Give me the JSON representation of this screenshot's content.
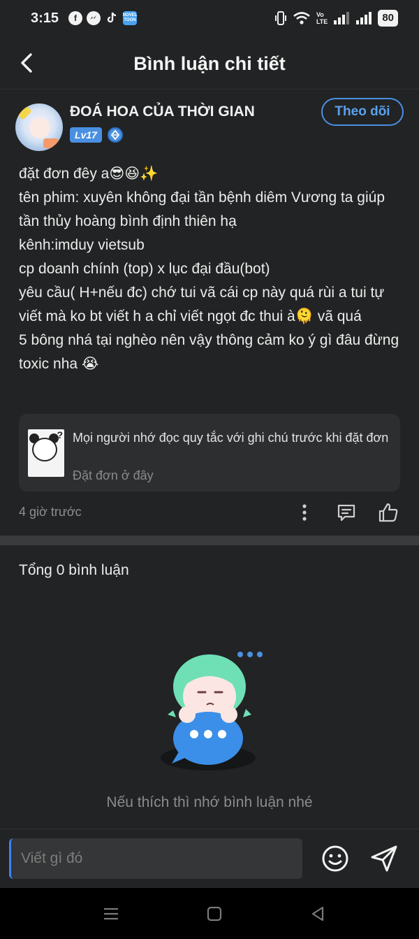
{
  "status_bar": {
    "time": "3:15",
    "apps": [
      "facebook-icon",
      "messenger-icon",
      "tiktok-icon",
      "novel-toon-icon"
    ],
    "novel_toon_label": "NOVEL TOON",
    "lte_label_top": "Vo",
    "lte_label_bottom": "LTE",
    "battery": "80"
  },
  "header": {
    "title": "Bình luận chi tiết"
  },
  "author": {
    "name": "ĐOÁ HOA CỦA THỜI GIAN",
    "level": "Lv17",
    "follow_label": "Theo dõi"
  },
  "post": {
    "lines": [
      "đặt đơn đêy a😎😆✨",
      "tên phim: xuyên không đại tần bệnh diêm Vương ta giúp tần thủy hoàng bình định thiên hạ",
      "kênh:imduy vietsub",
      "cp doanh chính (top) x lục đại đầu(bot)",
      "yêu cầu( H+nếu đc) chớ tui vã cái cp này quá rùi a tui tự viết mà ko bt viết h a chỉ viết ngọt đc thui à🫠 vã quá",
      "5 bông nhá tại nghèo nên vậy thông cảm ko ý gì đâu đừng toxic nha 😭"
    ]
  },
  "quote_card": {
    "text": "Mọi người nhớ đọc quy tắc với ghi chú trước khi đặt đơn",
    "link": "Đặt đơn ở đây"
  },
  "meta": {
    "time_ago": "4 giờ trước"
  },
  "comments": {
    "total_label": "Tổng 0 bình luận",
    "empty_text": "Nếu thích thì nhớ bình luận nhé"
  },
  "input": {
    "placeholder": "Viết gì đó"
  },
  "colors": {
    "background": "#222324",
    "accent": "#4a90e2",
    "card": "#2d2e30"
  }
}
